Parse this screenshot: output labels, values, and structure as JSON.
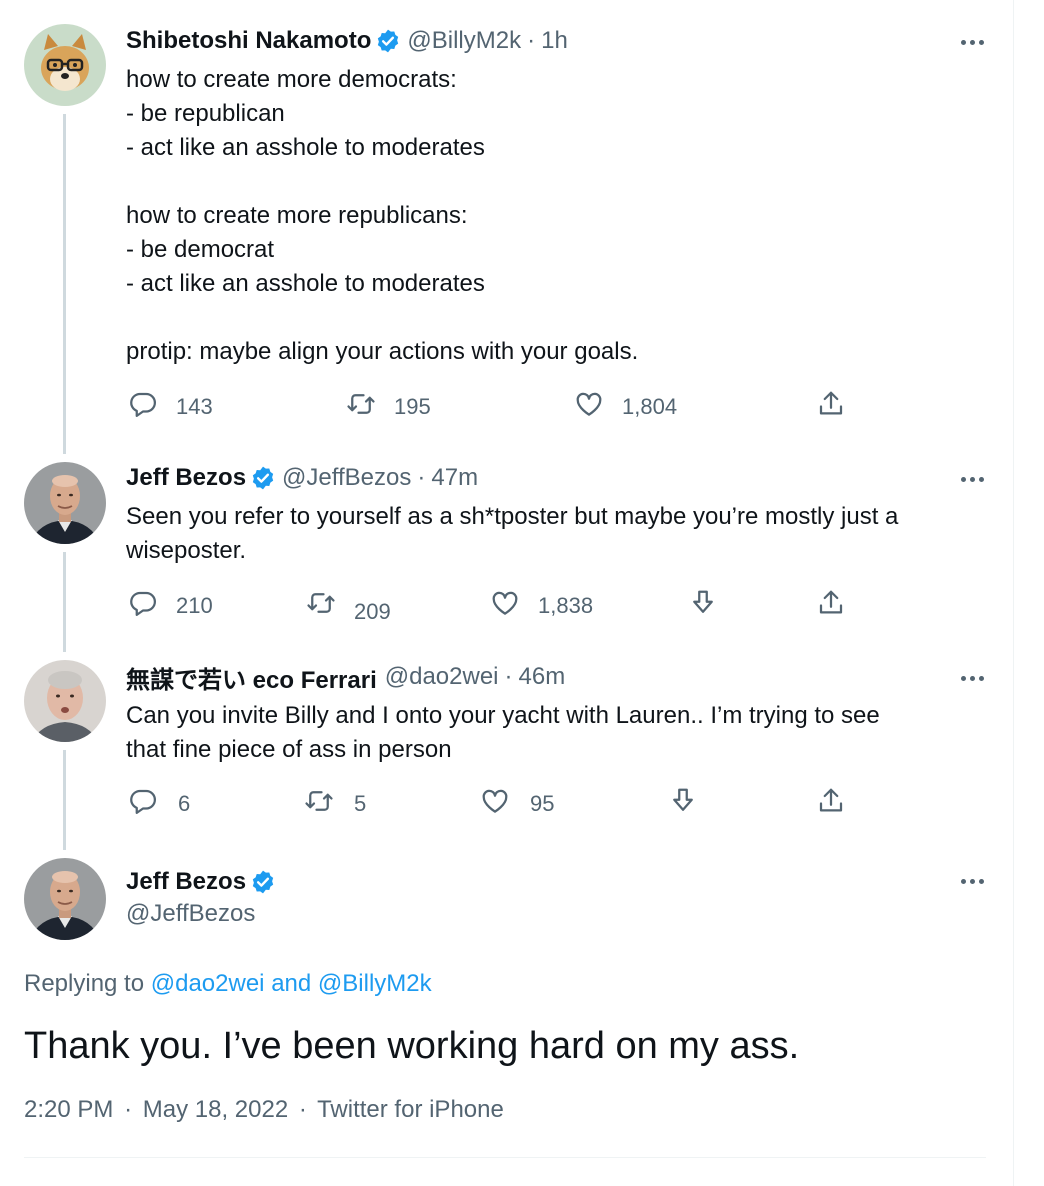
{
  "tweets": [
    {
      "name": "Shibetoshi Nakamoto",
      "handle": "@BillyM2k",
      "time": "1h",
      "text": "how to create more democrats:\n- be republican\n- act like an asshole to moderates\n\nhow to create more republicans:\n- be democrat\n- act like an asshole to moderates\n\nprotip: maybe align your actions with your goals.",
      "replies": "143",
      "retweets": "195",
      "likes": "1,804"
    },
    {
      "name": "Jeff Bezos",
      "handle": "@JeffBezos",
      "time": "47m",
      "text": "Seen you refer to yourself as a sh*tposter but maybe you’re mostly just a\nwiseposter.",
      "replies": "210",
      "retweets": "209",
      "likes": "1,838"
    },
    {
      "name": "無謀で若い eco Ferrari",
      "handle": "@dao2wei",
      "time": "46m",
      "text": "Can you invite Billy and I onto your yacht with Lauren.. I’m trying to see\nthat fine piece of ass in person",
      "replies": "6",
      "retweets": "5",
      "likes": "95"
    }
  ],
  "focused": {
    "name": "Jeff Bezos",
    "handle": "@JeffBezos",
    "replying_prefix": "Replying to",
    "replying_user1": "@dao2wei",
    "replying_and": "and",
    "replying_user2": "@BillyM2k",
    "text": "Thank you. I’ve been working hard on my ass.",
    "time": "2:20 PM",
    "date": "May 18, 2022",
    "source": "Twitter for iPhone"
  },
  "separator": "·",
  "colors": {
    "text": "#0f1419",
    "secondary": "#536471",
    "accent": "#1d9bf0",
    "thread_line": "#cfd9de"
  },
  "icons": [
    "reply-icon",
    "retweet-icon",
    "like-icon",
    "tip-icon",
    "share-icon",
    "verified-badge-icon",
    "more-icon"
  ]
}
